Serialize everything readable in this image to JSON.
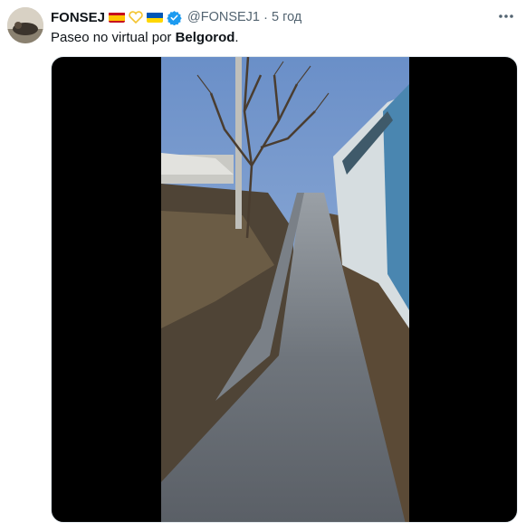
{
  "tweet": {
    "author_name": "FONSEJ",
    "handle": "@FONSEJ1",
    "separator": "·",
    "time": "5 год",
    "text_prefix": "Paseo no virtual por ",
    "text_bold": "Belgorod",
    "text_suffix": "."
  },
  "icons": {
    "flags": [
      "spain-flag-icon",
      "yellow-heart-icon",
      "ukraine-flag-icon"
    ],
    "verified": "verified-badge-icon",
    "more": "more-options-icon"
  },
  "colors": {
    "verified": "#1d9bf0",
    "secondary_text": "#536471"
  }
}
